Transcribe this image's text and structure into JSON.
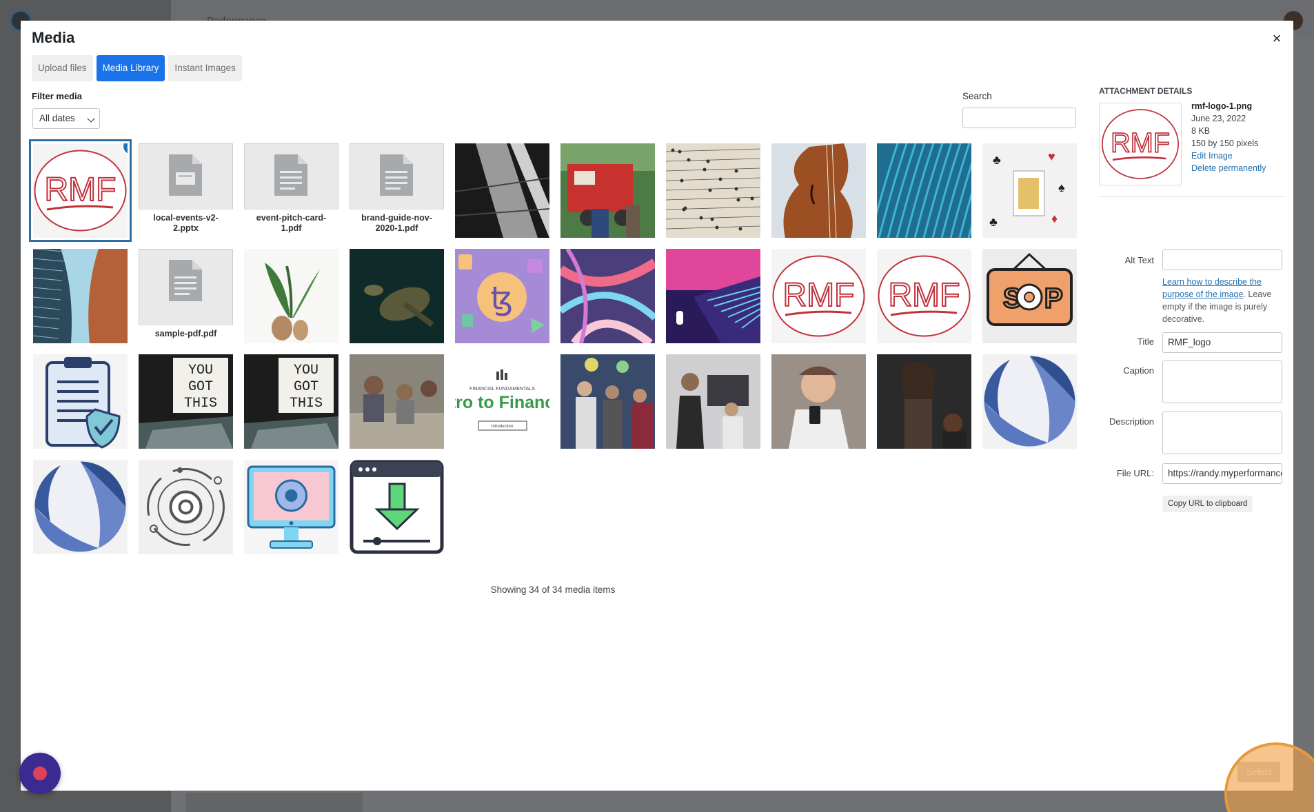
{
  "background": {
    "page_title": "Performance"
  },
  "modal": {
    "title": "Media",
    "close_glyph": "×",
    "tabs": [
      {
        "label": "Upload files",
        "active": false
      },
      {
        "label": "Media Library",
        "active": true
      },
      {
        "label": "Instant Images",
        "active": false
      }
    ],
    "filter_label": "Filter media",
    "filter_value": "All dates",
    "search_label": "Search",
    "search_value": ""
  },
  "grid": {
    "items": [
      {
        "name": "rmf-logo-1.png",
        "kind": "rmf-logo",
        "selected": true
      },
      {
        "name": "local-events-v2-2.pptx",
        "kind": "doc-slides"
      },
      {
        "name": "event-pitch-card-1.pdf",
        "kind": "doc"
      },
      {
        "name": "brand-guide-nov-2020-1.pdf",
        "kind": "doc"
      },
      {
        "name": "",
        "kind": "photo-tiles"
      },
      {
        "name": "",
        "kind": "photo-firetruck"
      },
      {
        "name": "",
        "kind": "photo-sheetmusic"
      },
      {
        "name": "",
        "kind": "photo-violin"
      },
      {
        "name": "",
        "kind": "photo-feathers"
      },
      {
        "name": "",
        "kind": "photo-cards"
      },
      {
        "name": "",
        "kind": "photo-building"
      },
      {
        "name": "sample-pdf.pdf",
        "kind": "doc"
      },
      {
        "name": "",
        "kind": "photo-plant"
      },
      {
        "name": "",
        "kind": "photo-turtle"
      },
      {
        "name": "",
        "kind": "photo-tezos"
      },
      {
        "name": "",
        "kind": "photo-abstract"
      },
      {
        "name": "",
        "kind": "photo-laptop"
      },
      {
        "name": "",
        "kind": "rmf-logo"
      },
      {
        "name": "",
        "kind": "rmf-logo"
      },
      {
        "name": "",
        "kind": "sop-sign"
      },
      {
        "name": "",
        "kind": "clipboard-shield"
      },
      {
        "name": "",
        "kind": "photo-yougotthis"
      },
      {
        "name": "",
        "kind": "photo-yougotthis"
      },
      {
        "name": "",
        "kind": "photo-meeting"
      },
      {
        "name": "",
        "kind": "financial-card"
      },
      {
        "name": "",
        "kind": "photo-party"
      },
      {
        "name": "",
        "kind": "photo-office"
      },
      {
        "name": "",
        "kind": "photo-phone"
      },
      {
        "name": "",
        "kind": "photo-dark"
      },
      {
        "name": "",
        "kind": "ball-logo"
      },
      {
        "name": "",
        "kind": "ball-logo"
      },
      {
        "name": "",
        "kind": "gear-orbit"
      },
      {
        "name": "",
        "kind": "monitor-gear"
      },
      {
        "name": "",
        "kind": "download-window"
      }
    ],
    "financial_card": {
      "top": "FINANCIAL FUNDAMENTALS",
      "main": "tro to Financ",
      "button": "Introduction"
    },
    "yougotthis_text": [
      "YOU",
      "GOT",
      "THIS"
    ],
    "rmf_text": "RMF",
    "sop_text": "SOP",
    "tezos_glyph": "ꜩ",
    "showing_text": "Showing 34 of 34 media items"
  },
  "details": {
    "heading": "ATTACHMENT DETAILS",
    "filename": "rmf-logo-1.png",
    "date": "June 23, 2022",
    "size": "8 KB",
    "dimensions": "150 by 150 pixels",
    "edit_link": "Edit Image",
    "delete_link": "Delete permanently",
    "alt_label": "Alt Text",
    "alt_value": "",
    "alt_help_link": "Learn how to describe the purpose of the image",
    "alt_help_rest": ". Leave empty if the image is purely decorative.",
    "title_label": "Title",
    "title_value": "RMF_logo",
    "caption_label": "Caption",
    "caption_value": "",
    "description_label": "Description",
    "description_value": "",
    "url_label": "File URL:",
    "url_value": "https://randy.myperformance",
    "copy_label": "Copy URL to clipboard"
  },
  "footer": {
    "select_label": "Select"
  },
  "icons": {
    "selected_check": "check-icon",
    "record": "record-icon"
  },
  "colors": {
    "accent": "#1a73e8",
    "link": "#2271b1",
    "rmf_red": "#c0323c",
    "highlight": "#f1a046"
  }
}
